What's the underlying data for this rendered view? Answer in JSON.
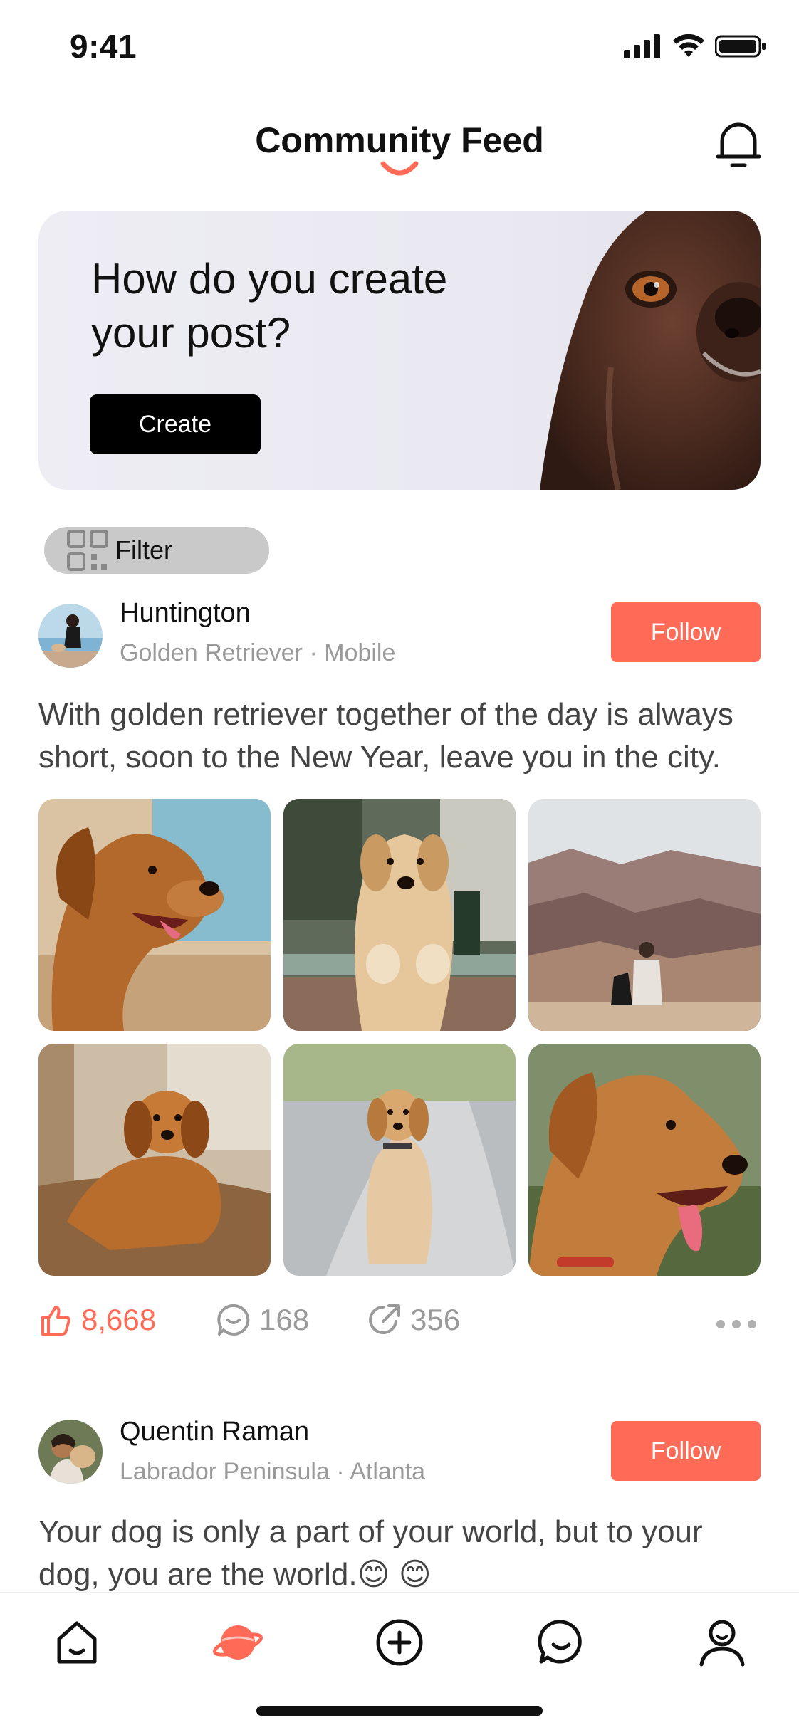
{
  "status_bar": {
    "time": "9:41",
    "icons": [
      "cellular-signal-icon",
      "wifi-icon",
      "battery-icon"
    ]
  },
  "header": {
    "title": "Community Feed",
    "bell_icon": "bell-icon"
  },
  "banner": {
    "heading": "How do you create your post?",
    "button_label": "Create"
  },
  "filter": {
    "label": "Filter",
    "icon": "qr-grid-icon"
  },
  "posts": [
    {
      "username": "Huntington",
      "breed": "Golden Retriever",
      "location": "Mobile",
      "subline": "Golden Retriever · Mobile",
      "follow_label": "Follow",
      "text": "With golden retriever together of the day is always short, soon to the New Year, leave you in the city.",
      "photos": [
        "golden-retriever-profile-beach",
        "golden-retriever-paws-on-rail",
        "person-and-dog-canyon",
        "golden-puppy-on-couch",
        "golden-puppy-sitting-path",
        "golden-retriever-tongue-out"
      ],
      "likes": "8,668",
      "comments": "168",
      "shares": "356"
    },
    {
      "username": "Quentin Raman",
      "breed": "Labrador Peninsula",
      "location": "Atlanta",
      "subline": "Labrador Peninsula · Atlanta",
      "follow_label": "Follow",
      "text": "Your dog is only a part of your world, but to your dog, you are the world.😊 😊"
    }
  ],
  "tab_bar": {
    "tabs": [
      {
        "name": "home",
        "icon": "home-icon",
        "active": false
      },
      {
        "name": "explore",
        "icon": "planet-icon",
        "active": true
      },
      {
        "name": "create",
        "icon": "plus-circle-icon",
        "active": false
      },
      {
        "name": "messages",
        "icon": "chat-icon",
        "active": false
      },
      {
        "name": "profile",
        "icon": "profile-icon",
        "active": false
      }
    ]
  },
  "colors": {
    "accent": "#ff6b57",
    "banner_bg": "#eeedf4",
    "text_primary": "#111111",
    "text_secondary": "#9a9a9a"
  }
}
